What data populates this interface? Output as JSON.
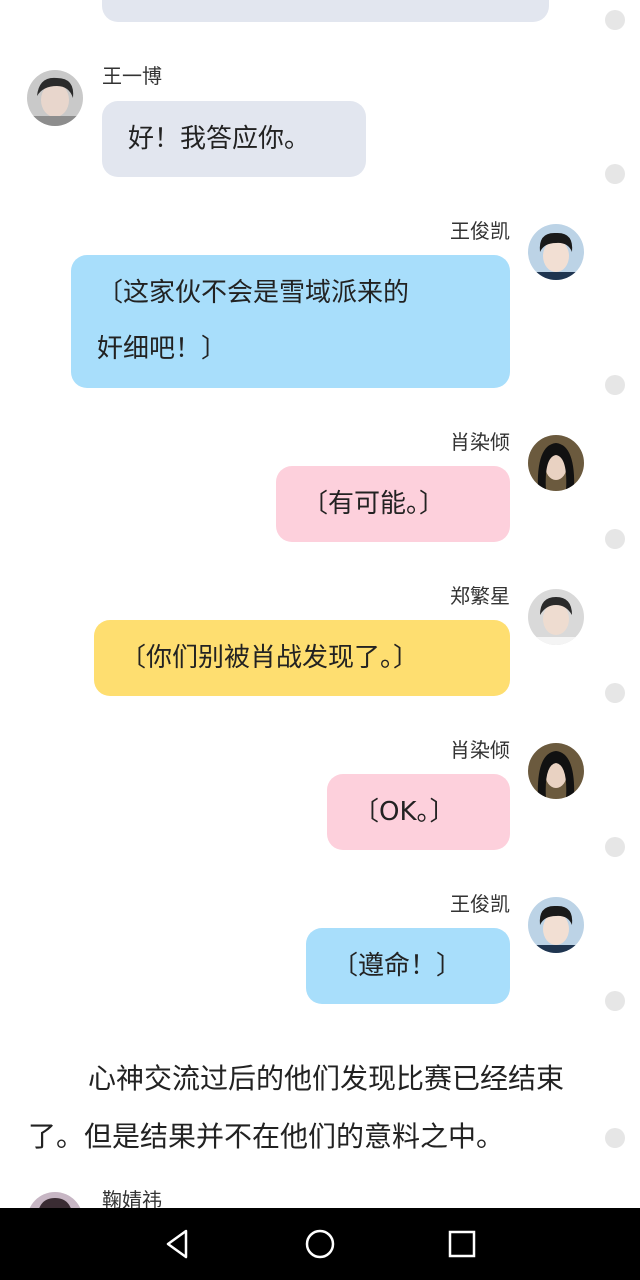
{
  "messages": [
    {
      "sender": "王一博",
      "text": "好！我答应你。"
    },
    {
      "sender": "王俊凯",
      "line1": "〔这家伙不会是雪域派来的",
      "line2": "奸细吧！〕"
    },
    {
      "sender": "肖染倾",
      "text": "〔有可能。〕"
    },
    {
      "sender": "郑繁星",
      "text": "〔你们别被肖战发现了。〕"
    },
    {
      "sender": "肖染倾",
      "text": "〔OK。〕"
    },
    {
      "sender": "王俊凯",
      "text": "〔遵命！〕"
    }
  ],
  "narration": "心神交流过后的他们发现比赛已经结束了。但是结果并不在他们的意料之中。",
  "next_sender": "鞠婧祎",
  "nav": {
    "back": "back-icon",
    "home": "home-icon",
    "recents": "recents-icon"
  },
  "colors": {
    "gray_bubble": "#e2e6ef",
    "blue_bubble": "#a8defb",
    "pink_bubble": "#fdd0dc",
    "yellow_bubble": "#fede70",
    "navbar": "#000000"
  }
}
